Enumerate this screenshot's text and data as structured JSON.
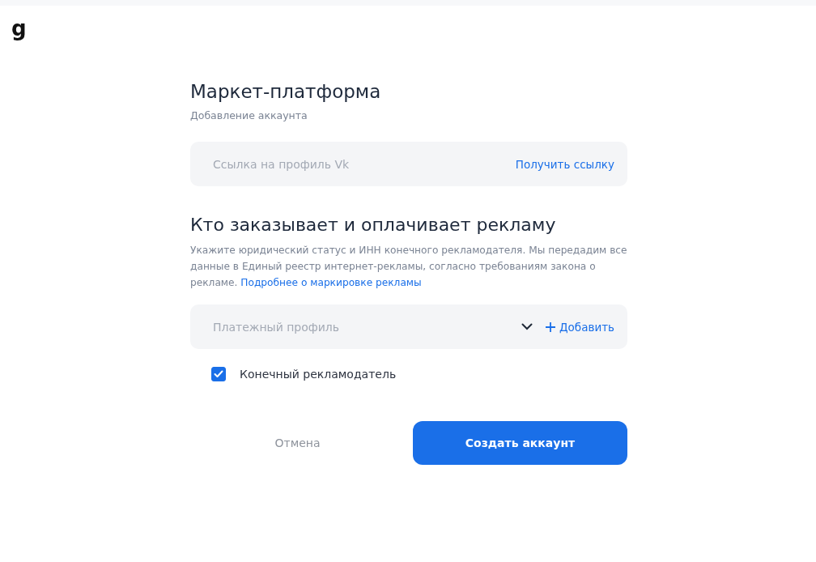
{
  "logo": "g",
  "title": "Маркет-платформа",
  "subtitle": "Добавление аккаунта",
  "link_field": {
    "placeholder": "Ссылка на профиль Vk",
    "action": "Получить ссылку"
  },
  "section": {
    "heading": "Кто заказывает и оплачивает рекламу",
    "text": "Укажите юридический статус и ИНН конечного рекламодателя. Мы передадим все данные в Единый реестр интернет-рекламы, согласно требованиям закона о рекламе.",
    "link": "Подробнее о маркировке рекламы"
  },
  "payment_select": {
    "placeholder": "Платежный профиль",
    "add": "Добавить"
  },
  "checkbox": {
    "label": "Конечный рекламодатель",
    "checked": true
  },
  "buttons": {
    "cancel": "Отмена",
    "submit": "Создать аккаунт"
  }
}
